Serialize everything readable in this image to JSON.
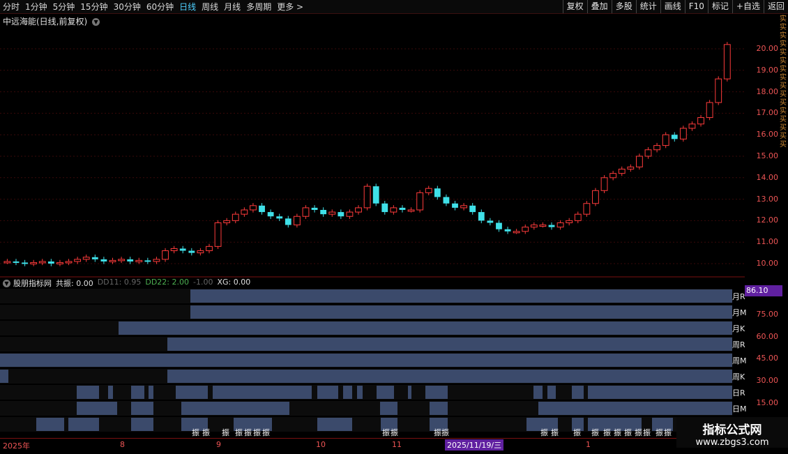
{
  "periods": [
    "分时",
    "1分钟",
    "5分钟",
    "15分钟",
    "30分钟",
    "60分钟",
    "日线",
    "周线",
    "月线",
    "多周期",
    "更多 >"
  ],
  "active_period": "日线",
  "tools": [
    "复权",
    "叠加",
    "多股",
    "统计",
    "画线",
    "F10",
    "标记",
    "+自选",
    "返回"
  ],
  "chart_title": "中远海能(日线,前复权)",
  "price_axis": [
    "20.00",
    "19.00",
    "18.00",
    "17.00",
    "16.00",
    "15.00",
    "14.00",
    "13.00",
    "12.00",
    "11.00",
    "10.00"
  ],
  "indicator": {
    "name": "股朋指标网",
    "items": [
      {
        "label": "共振: 0.00",
        "color": "#e0e0e0"
      },
      {
        "label": "DD11: 0.95",
        "color": "#666"
      },
      {
        "label": "DD22: 2.00",
        "color": "#4caf50"
      },
      {
        "label": "-1.00",
        "color": "#666"
      },
      {
        "label": "XG: 0.00",
        "color": "#e0e0e0"
      }
    ],
    "row_labels": [
      "月R",
      "月M",
      "月K",
      "周R",
      "周M",
      "周K",
      "日R",
      "日M"
    ],
    "scale": [
      "75.00",
      "60.00",
      "45.00",
      "30.00",
      "15.00"
    ],
    "badge": "86.10",
    "marker_text": "振"
  },
  "date_axis": {
    "labels": [
      "2025年",
      "8",
      "9",
      "10",
      "11",
      "1"
    ],
    "selected": "2025/11/19/三"
  },
  "watermark": {
    "line1": "指标公式网",
    "line2": "www.zbgs3.com"
  },
  "side_text": "实实实实实实实实买买买实买买买买"
}
